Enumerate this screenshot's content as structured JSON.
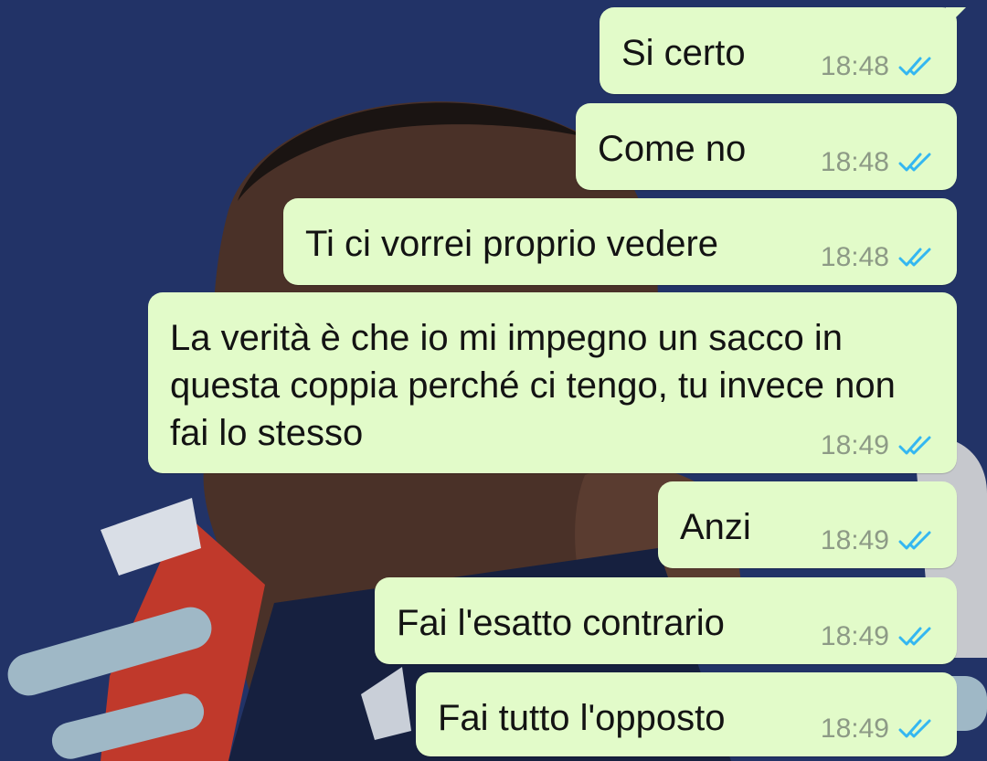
{
  "colors": {
    "wallpaper": "#24366a",
    "bubble_outgoing": "#e2fbc9",
    "message_text": "#131313",
    "timestamp": "#8d9a86",
    "read_receipt": "#34b7f1"
  },
  "messages": [
    {
      "text": "Si certo",
      "time": "18:48",
      "status_icon": "double-check-icon",
      "status": "read"
    },
    {
      "text": "Come no",
      "time": "18:48",
      "status_icon": "double-check-icon",
      "status": "read"
    },
    {
      "text": "Ti ci vorrei proprio vedere",
      "time": "18:48",
      "status_icon": "double-check-icon",
      "status": "read"
    },
    {
      "text": "La verità è che io mi impegno un sacco in questa coppia perché ci tengo, tu invece non fai lo stesso",
      "time": "18:49",
      "status_icon": "double-check-icon",
      "status": "read"
    },
    {
      "text": "Anzi",
      "time": "18:49",
      "status_icon": "double-check-icon",
      "status": "read"
    },
    {
      "text": "Fai l'esatto contrario",
      "time": "18:49",
      "status_icon": "double-check-icon",
      "status": "read"
    },
    {
      "text": "Fai tutto l'opposto",
      "time": "18:49",
      "status_icon": "double-check-icon",
      "status": "read"
    }
  ]
}
